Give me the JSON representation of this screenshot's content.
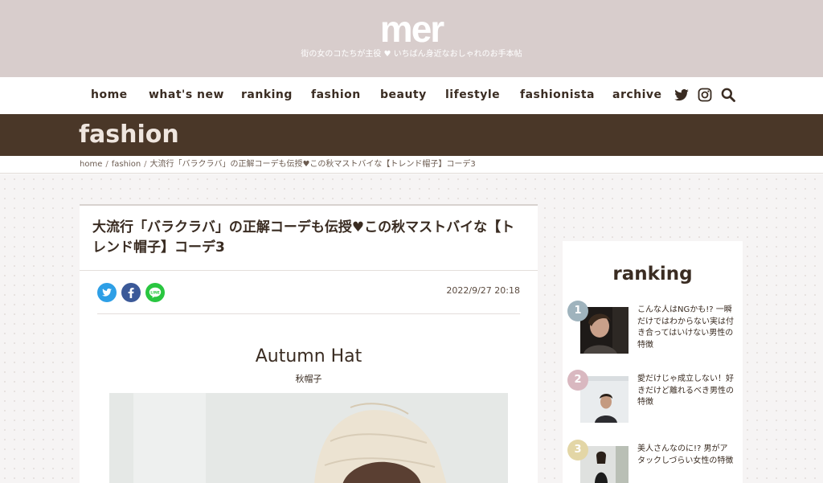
{
  "header": {
    "logo": "mer",
    "tagline_left": "街の女のコたちが主役",
    "tagline_heart": "♥",
    "tagline_right": "いちばん身近なおしゃれのお手本帖"
  },
  "nav": {
    "items": [
      "home",
      "what's new",
      "ranking",
      "fashion",
      "beauty",
      "lifestyle",
      "fashionista",
      "archive"
    ],
    "icons": [
      "twitter-icon",
      "instagram-icon",
      "search-icon"
    ]
  },
  "category": {
    "title": "fashion"
  },
  "breadcrumb": {
    "items": [
      "home",
      "fashion",
      "大流行「バラクラバ」の正解コーデも伝授♥この秋マストバイな【トレンド帽子】コーデ3"
    ],
    "separator": "/"
  },
  "article": {
    "title": "大流行「バラクラバ」の正解コーデも伝授♥この秋マストバイな【トレンド帽子】コーデ3",
    "date": "2022/9/27 20:18",
    "share": [
      "twitter",
      "facebook",
      "line"
    ],
    "line_label": "LINE",
    "section_title": "Autumn Hat",
    "section_subtitle": "秋帽子"
  },
  "sidebar": {
    "title": "ranking",
    "items": [
      {
        "rank": "1",
        "text": "こんな人はNGかも!? 一瞬だけではわからない実は付き合ってはいけない男性の特徴",
        "color": "#9fb3bd"
      },
      {
        "rank": "2",
        "text": "愛だけじゃ成立しない！好きだけど離れるべき男性の特徴",
        "color": "#d9b8c0"
      },
      {
        "rank": "3",
        "text": "美人さんなのに!? 男がアタックしづらい女性の特徴",
        "color": "#e3d6a6"
      }
    ]
  },
  "colors": {
    "header_bg": "#d8cdcc",
    "category_bar": "#4a3728",
    "text": "#3a2c22",
    "twitter": "#2e9fe6",
    "facebook": "#3b5998",
    "line": "#29c640"
  }
}
